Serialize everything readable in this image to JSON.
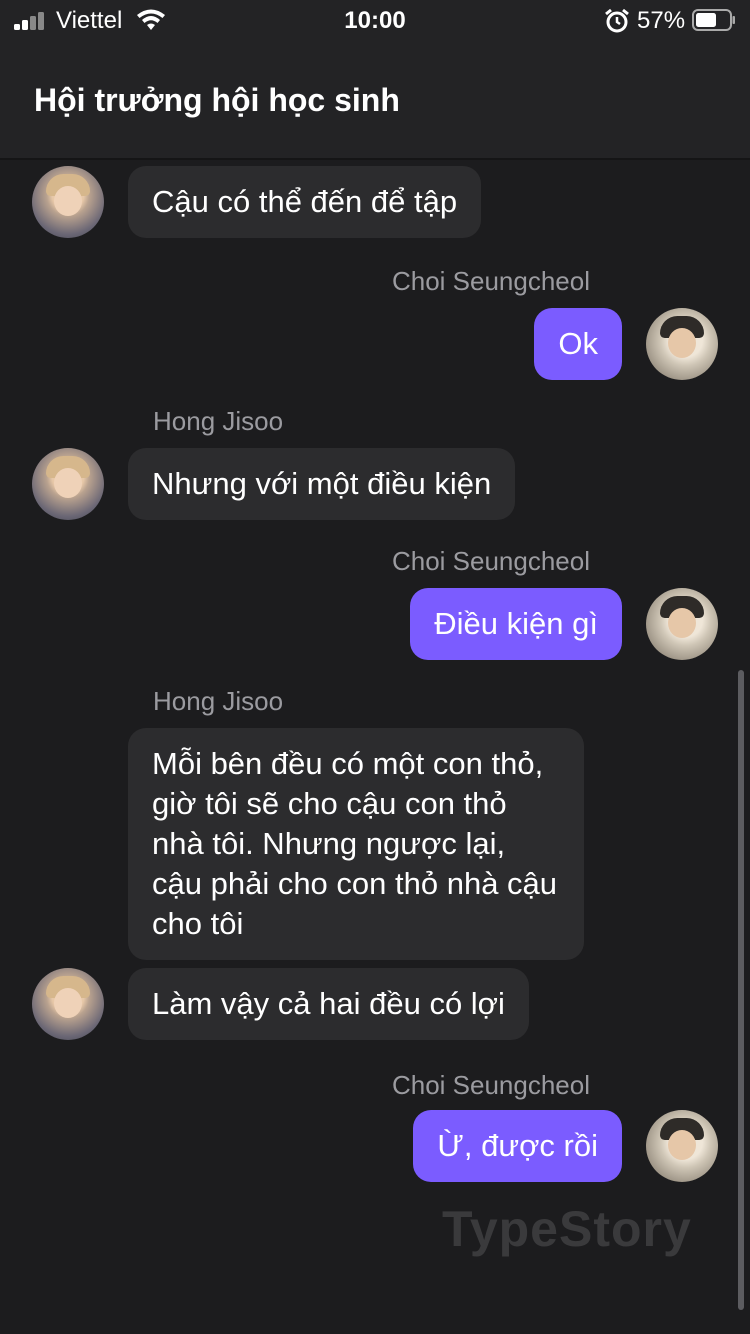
{
  "status_bar": {
    "carrier": "Viettel",
    "time": "10:00",
    "battery_percent": "57%",
    "icons": [
      "signal-icon",
      "wifi-icon",
      "alarm-icon",
      "battery-icon"
    ]
  },
  "header": {
    "title": "Hội trưởng hội học sinh"
  },
  "messages": [
    {
      "side": "left",
      "text": "Cậu có thể đến để tập"
    },
    {
      "side": "right",
      "sender": "Choi Seungcheol",
      "text": "Ok"
    },
    {
      "side": "left",
      "sender": "Hong Jisoo",
      "text": "Nhưng với một điều kiện"
    },
    {
      "side": "right",
      "sender": "Choi Seungcheol",
      "text": "Điều kiện gì"
    },
    {
      "side": "left",
      "sender": "Hong Jisoo",
      "text": "Mỗi bên đều có một con thỏ, giờ tôi sẽ cho cậu con thỏ nhà tôi. Nhưng ngược lại, cậu phải cho con thỏ nhà cậu cho tôi"
    },
    {
      "side": "left",
      "text": "Làm vậy cả hai đều có lợi"
    },
    {
      "side": "right",
      "sender": "Choi Seungcheol",
      "text": "Ừ, được rồi"
    }
  ],
  "watermark": "TypeStory",
  "colors": {
    "background": "#1c1c1e",
    "incoming_bubble": "#2c2c2e",
    "outgoing_bubble": "#7b5cff",
    "sender_name": "#9b9ba0"
  }
}
